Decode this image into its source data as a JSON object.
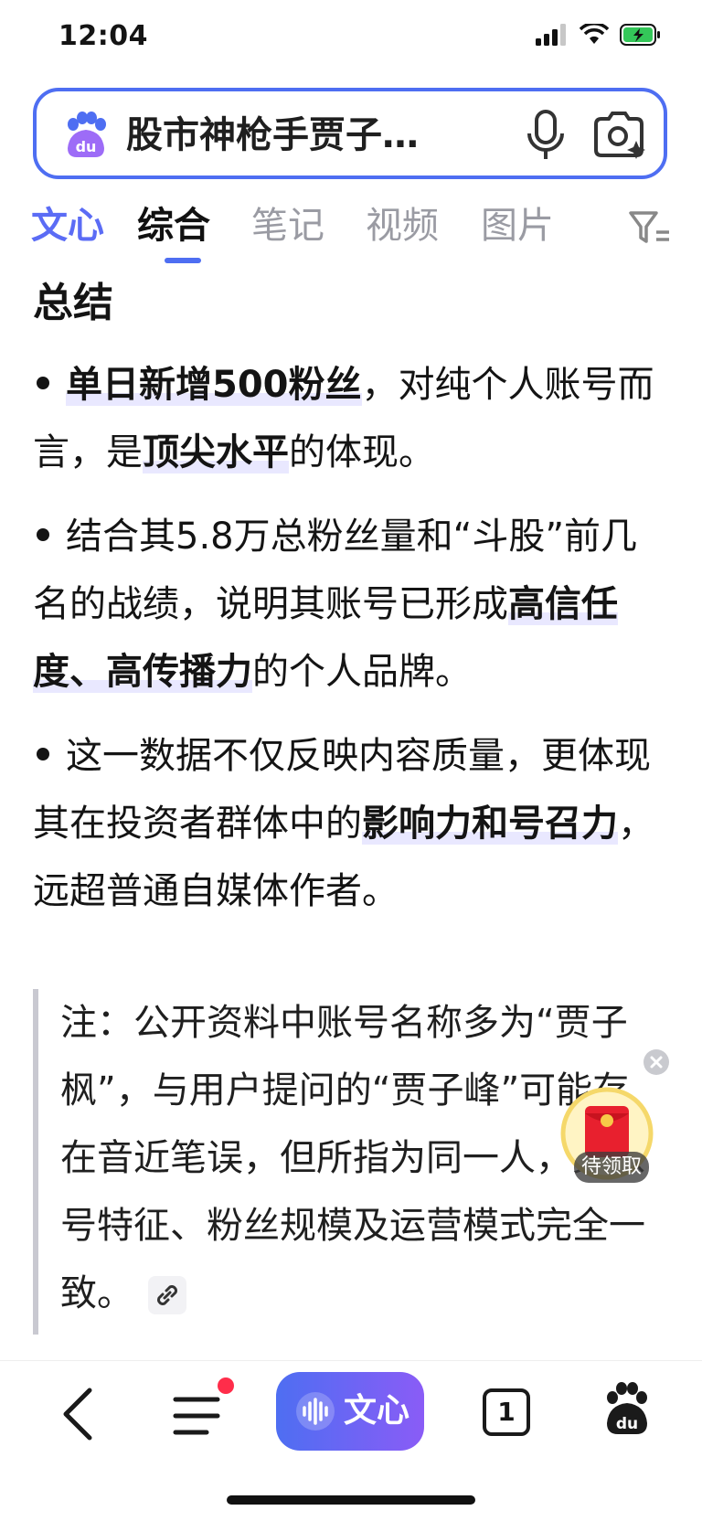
{
  "status": {
    "time": "12:04"
  },
  "search": {
    "query": "股市神枪手贾子…"
  },
  "tabs": [
    {
      "label": "文心"
    },
    {
      "label": "综合"
    },
    {
      "label": "笔记"
    },
    {
      "label": "视频"
    },
    {
      "label": "图片"
    }
  ],
  "content": {
    "heading": "总结",
    "bullets": [
      {
        "parts": [
          {
            "t": "单日新增500粉丝"
          },
          {
            "t": "，对纯个人账号而言，是"
          },
          {
            "t": "顶尖水平"
          },
          {
            "t": "的体现。"
          }
        ]
      },
      {
        "parts": [
          {
            "t": "结合其5.8万总粉丝量和“斗股”前几名的战绩，说明其账号已形成"
          },
          {
            "t": "高信任度、高传播力"
          },
          {
            "t": "的个人品牌。"
          }
        ]
      },
      {
        "parts": [
          {
            "t": "这一数据不仅反映内容质量，更体现其在投资者群体中的"
          },
          {
            "t": "影响力和号召力"
          },
          {
            "t": "，远超普通自媒体作者。"
          }
        ]
      }
    ],
    "note": "注：公开资料中账号名称多为“贾子枫”，与用户提问的“贾子峰”可能存在音近笔误，但所指为同一人，其账号特征、粉丝规模及运营模式完全一致。"
  },
  "red_packet": {
    "label": "待领取"
  },
  "bottom_nav": {
    "wenxin_label": "文心",
    "tabs_count": "1"
  },
  "colors": {
    "accent": "#4e6ef2",
    "highlight_bg": "#e9e8ff",
    "badge_red": "#ff2d4a"
  }
}
